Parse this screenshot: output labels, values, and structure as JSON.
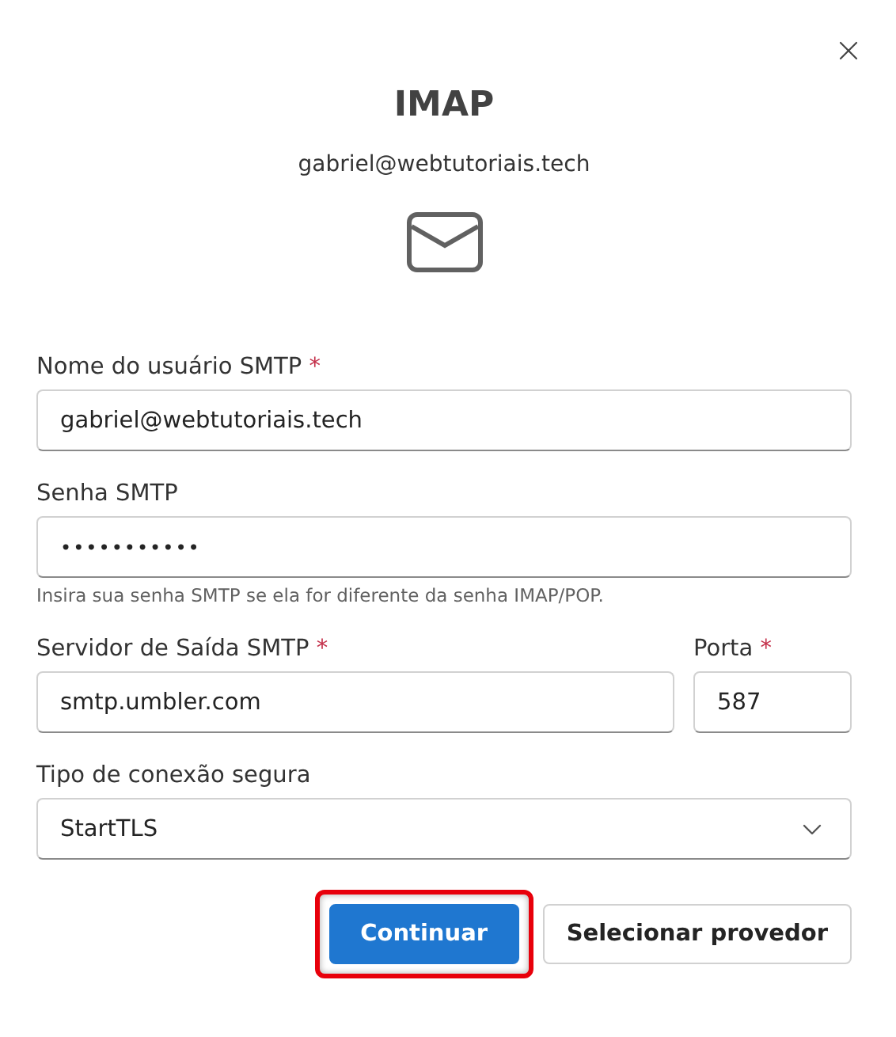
{
  "dialog": {
    "title": "IMAP",
    "account": "gabriel@webtutoriais.tech"
  },
  "rows": [
    {
      "fields": [
        {
          "kind": "text",
          "label": "Nome do usuário SMTP",
          "marker": "*",
          "value": "gabriel@webtutoriais.tech"
        }
      ]
    },
    {
      "fields": [
        {
          "kind": "password",
          "label": "Senha SMTP",
          "value": "•••••••••••",
          "hint": "Insira sua senha SMTP se ela for diferente da senha IMAP/POP."
        }
      ]
    },
    {
      "fields": [
        {
          "kind": "text",
          "label": "Servidor de Saída SMTP",
          "marker": "*",
          "value": "smtp.umbler.com"
        },
        {
          "kind": "port",
          "label": "Porta",
          "marker": "*",
          "value": "587"
        }
      ]
    },
    {
      "fields": [
        {
          "kind": "select",
          "label": "Tipo de conexão segura",
          "value": "StartTLS"
        }
      ]
    }
  ],
  "buttons": [
    {
      "kind": "primary",
      "label": "Continuar",
      "highlighted": true
    },
    {
      "kind": "secondary",
      "label": "Selecionar provedor",
      "highlighted": false
    }
  ]
}
